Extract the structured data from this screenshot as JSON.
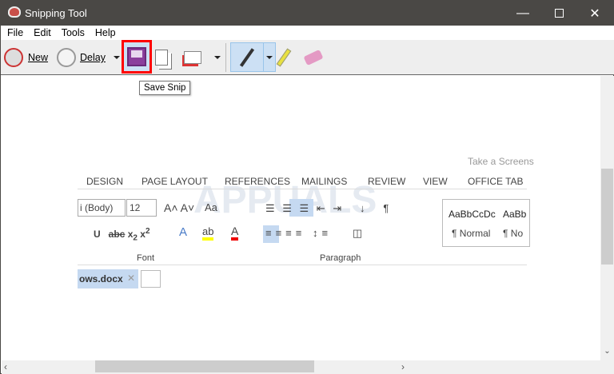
{
  "window": {
    "title": "Snipping Tool"
  },
  "menu": [
    "File",
    "Edit",
    "Tools",
    "Help"
  ],
  "toolbar": {
    "new_label": "New",
    "delay_label": "Delay",
    "tooltip": "Save Snip",
    "highlight_color": "#ff0000"
  },
  "snip": {
    "take_screenshot": "Take a Screens",
    "tabs": [
      "DESIGN",
      "PAGE LAYOUT",
      "REFERENCES",
      "MAILINGS",
      "REVIEW",
      "VIEW",
      "OFFICE TAB"
    ],
    "font_name": "i (Body)",
    "font_size": "12",
    "change_case": "Aa",
    "styles": [
      "AaBbCcDc",
      "AaBb"
    ],
    "style_names": [
      "¶ Normal",
      "¶ No"
    ],
    "group_font": "Font",
    "group_paragraph": "Paragraph",
    "doc_tab": "ows.docx",
    "watermark": "APPUALS"
  }
}
